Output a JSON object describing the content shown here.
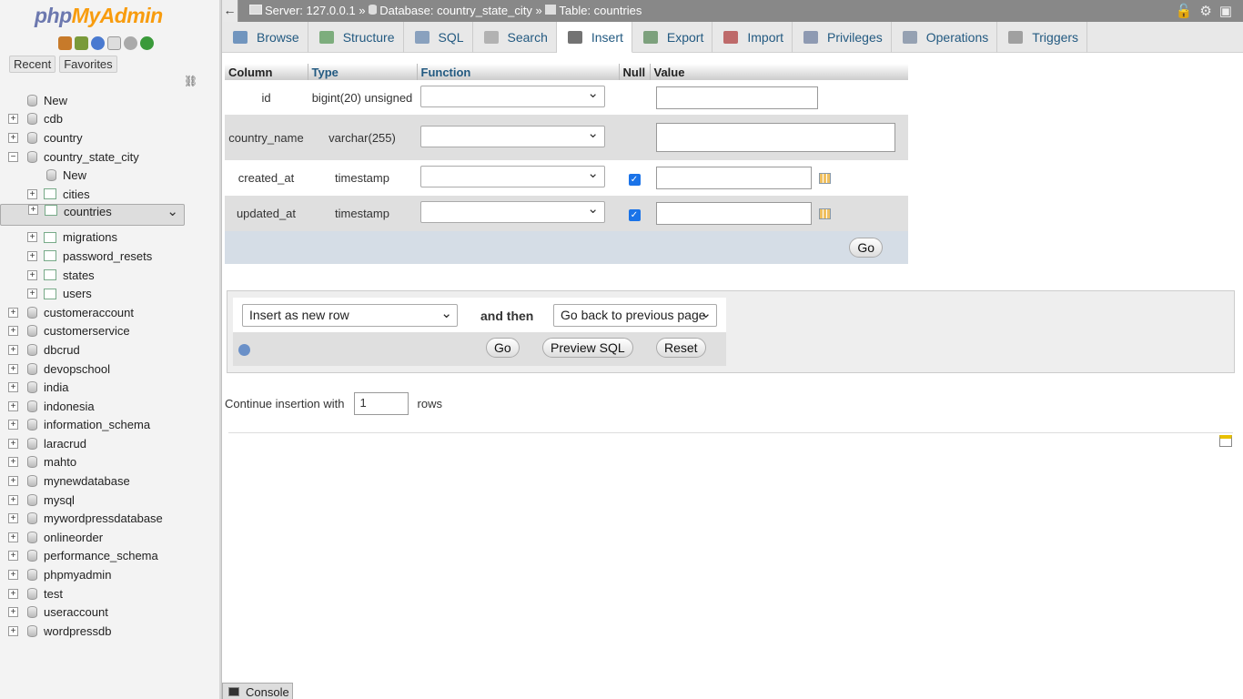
{
  "nav": {
    "logo_a": "php",
    "logo_b": "MyAdmin",
    "recent": "Recent",
    "favorites": "Favorites",
    "tree": [
      {
        "label": "New",
        "level": 0,
        "type": "new"
      },
      {
        "label": "cdb",
        "level": 0,
        "type": "db"
      },
      {
        "label": "country",
        "level": 0,
        "type": "db"
      },
      {
        "label": "country_state_city",
        "level": 0,
        "type": "db",
        "open": true
      },
      {
        "label": "New",
        "level": 1,
        "type": "new"
      },
      {
        "label": "cities",
        "level": 1,
        "type": "table"
      },
      {
        "label": "countries",
        "level": 1,
        "type": "table",
        "selected": true
      },
      {
        "label": "migrations",
        "level": 1,
        "type": "table"
      },
      {
        "label": "password_resets",
        "level": 1,
        "type": "table"
      },
      {
        "label": "states",
        "level": 1,
        "type": "table"
      },
      {
        "label": "users",
        "level": 1,
        "type": "table"
      },
      {
        "label": "customeraccount",
        "level": 0,
        "type": "db"
      },
      {
        "label": "customerservice",
        "level": 0,
        "type": "db"
      },
      {
        "label": "dbcrud",
        "level": 0,
        "type": "db"
      },
      {
        "label": "devopschool",
        "level": 0,
        "type": "db"
      },
      {
        "label": "india",
        "level": 0,
        "type": "db"
      },
      {
        "label": "indonesia",
        "level": 0,
        "type": "db"
      },
      {
        "label": "information_schema",
        "level": 0,
        "type": "db"
      },
      {
        "label": "laracrud",
        "level": 0,
        "type": "db"
      },
      {
        "label": "mahto",
        "level": 0,
        "type": "db"
      },
      {
        "label": "mynewdatabase",
        "level": 0,
        "type": "db"
      },
      {
        "label": "mysql",
        "level": 0,
        "type": "db"
      },
      {
        "label": "mywordpressdatabase",
        "level": 0,
        "type": "db"
      },
      {
        "label": "onlineorder",
        "level": 0,
        "type": "db"
      },
      {
        "label": "performance_schema",
        "level": 0,
        "type": "db"
      },
      {
        "label": "phpmyadmin",
        "level": 0,
        "type": "db"
      },
      {
        "label": "test",
        "level": 0,
        "type": "db"
      },
      {
        "label": "useraccount",
        "level": 0,
        "type": "db"
      },
      {
        "label": "wordpressdb",
        "level": 0,
        "type": "db"
      }
    ]
  },
  "breadcrumb": {
    "server": "Server: 127.0.0.1",
    "sep1": "»",
    "database": "Database: country_state_city",
    "sep2": "»",
    "table": "Table: countries"
  },
  "tabs": [
    {
      "label": "Browse",
      "color": "#4a7ab0"
    },
    {
      "label": "Structure",
      "color": "#5a9a5a"
    },
    {
      "label": "SQL",
      "color": "#6a8ab0"
    },
    {
      "label": "Search",
      "color": "#a0a0a0"
    },
    {
      "label": "Insert",
      "color": "#444",
      "active": true
    },
    {
      "label": "Export",
      "color": "#5a8a5a"
    },
    {
      "label": "Import",
      "color": "#b04040"
    },
    {
      "label": "Privileges",
      "color": "#7080a0"
    },
    {
      "label": "Operations",
      "color": "#7a8aa0"
    },
    {
      "label": "Triggers",
      "color": "#888"
    }
  ],
  "insert": {
    "headers": {
      "column": "Column",
      "type": "Type",
      "function": "Function",
      "null": "Null",
      "value": "Value"
    },
    "rows": [
      {
        "column": "id",
        "type": "bigint(20) unsigned",
        "null": false,
        "input": "text",
        "calendar": false
      },
      {
        "column": "country_name",
        "type": "varchar(255)",
        "null": false,
        "input": "textarea",
        "calendar": false
      },
      {
        "column": "created_at",
        "type": "timestamp",
        "null": true,
        "input": "text",
        "calendar": true
      },
      {
        "column": "updated_at",
        "type": "timestamp",
        "null": true,
        "input": "text",
        "calendar": true
      }
    ],
    "go": "Go"
  },
  "options": {
    "insert_mode": "Insert as new row",
    "and_then": "and then",
    "after": "Go back to previous page",
    "go": "Go",
    "preview": "Preview SQL",
    "reset": "Reset"
  },
  "continue": {
    "label": "Continue insertion with",
    "value": "1",
    "suffix": "rows"
  },
  "console": "Console"
}
